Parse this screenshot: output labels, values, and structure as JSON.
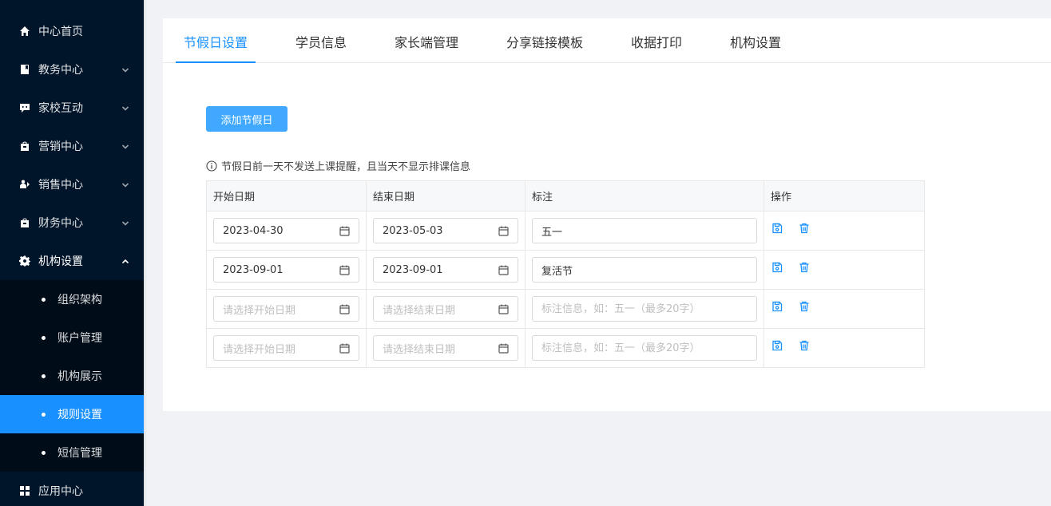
{
  "sidebar": {
    "items": [
      {
        "label": "中心首页",
        "icon": "home-icon"
      },
      {
        "label": "教务中心",
        "icon": "book-icon"
      },
      {
        "label": "家校互动",
        "icon": "chat-icon"
      },
      {
        "label": "营销中心",
        "icon": "bag-icon"
      },
      {
        "label": "销售中心",
        "icon": "sales-icon"
      },
      {
        "label": "财务中心",
        "icon": "wallet-icon"
      },
      {
        "label": "机构设置",
        "icon": "gear-icon"
      }
    ],
    "subitems": [
      "组织架构",
      "账户管理",
      "机构展示",
      "规则设置",
      "短信管理"
    ],
    "active_sub": "规则设置",
    "bottom_item": {
      "label": "应用中心",
      "icon": "apps-icon"
    }
  },
  "tabs": [
    "节假日设置",
    "学员信息",
    "家长端管理",
    "分享链接模板",
    "收据打印",
    "机构设置"
  ],
  "active_tab": "节假日设置",
  "add_button": "添加节假日",
  "tip": "节假日前一天不发送上课提醒，且当天不显示排课信息",
  "table": {
    "headers": [
      "开始日期",
      "结束日期",
      "标注",
      "操作"
    ],
    "rows": [
      {
        "start": "2023-04-30",
        "end": "2023-05-03",
        "note": "五一"
      },
      {
        "start": "2023-09-01",
        "end": "2023-09-01",
        "note": "复活节"
      },
      {
        "start": "",
        "end": "",
        "note": ""
      },
      {
        "start": "",
        "end": "",
        "note": ""
      }
    ],
    "placeholders": {
      "start": "请选择开始日期",
      "end": "请选择结束日期",
      "note": "标注信息，如：五一（最多20字）"
    }
  },
  "colors": {
    "primary": "#1890ff",
    "sidebar_bg": "#001529",
    "submenu_bg": "#000c17"
  }
}
